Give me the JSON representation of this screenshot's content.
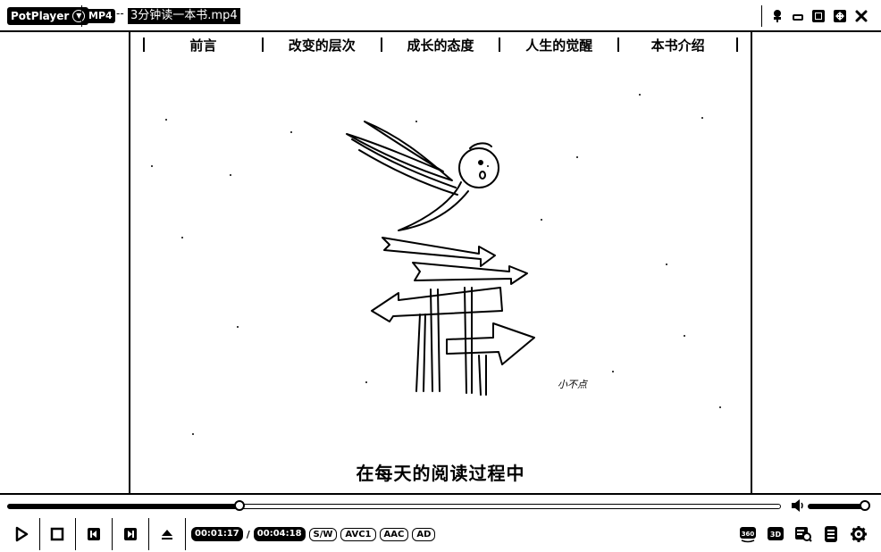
{
  "app": {
    "name": "PotPlayer",
    "format_badge": "MP4",
    "title_separator": "--",
    "file_title": "3分钟读一本书.mp4"
  },
  "chapters": [
    "前言",
    "改变的层次",
    "成长的态度",
    "人生的觉醒",
    "本书介绍"
  ],
  "video": {
    "subtitle": "在每天的阅读过程中",
    "signature": "小不点"
  },
  "playback": {
    "current_time": "00:01:17",
    "separator": "/",
    "total_time": "00:04:18",
    "progress": 0.3,
    "volume": 0.95,
    "codec_badges": [
      "S/W",
      "AVC1",
      "AAC",
      "AD"
    ]
  },
  "right_controls": {
    "vr_label": "360",
    "three_d_label": "3D"
  },
  "icons": {
    "window": [
      "pin-icon",
      "minimize-icon",
      "restore-icon",
      "fullscreen-icon",
      "close-icon"
    ],
    "playback": [
      "play-icon",
      "stop-icon",
      "previous-icon",
      "next-icon",
      "eject-icon"
    ],
    "right": [
      "vr-360-icon",
      "3d-icon",
      "capture-icon",
      "playlist-icon",
      "settings-icon"
    ]
  }
}
